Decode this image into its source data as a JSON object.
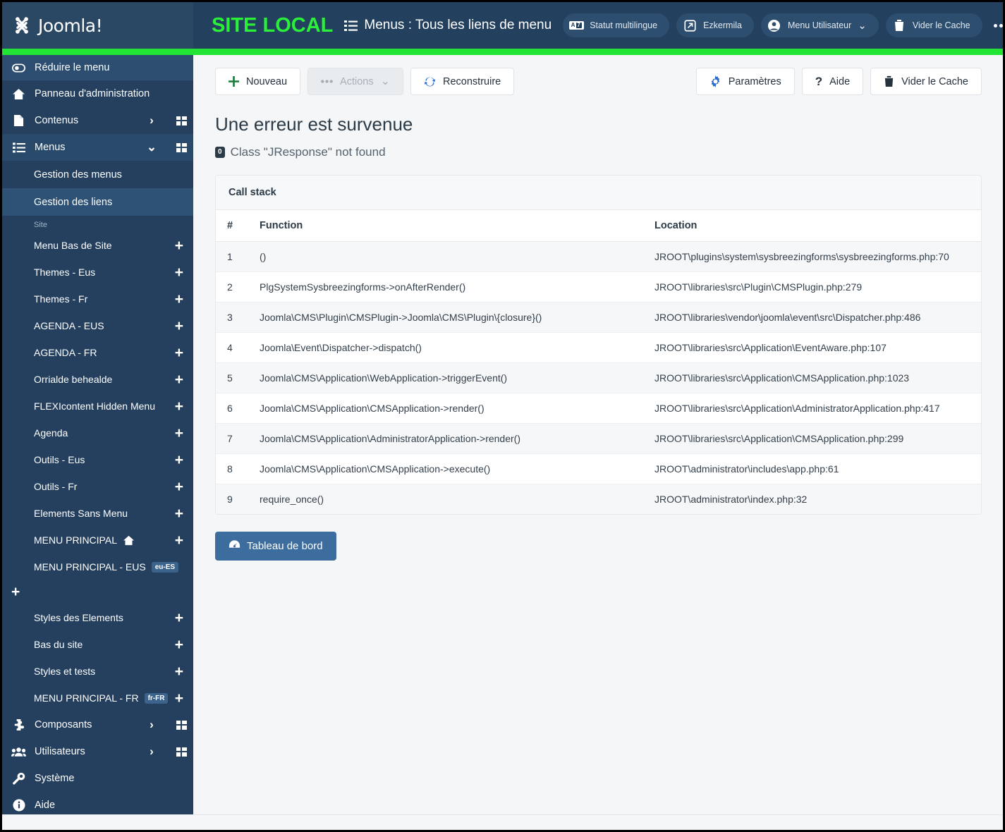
{
  "header": {
    "brand": "Joomla!",
    "site_label": "SITE LOCAL",
    "page_title": "Menus : Tous les liens de menu",
    "buttons": [
      {
        "label": "Statut multilingue",
        "icon": "multilingual-icon"
      },
      {
        "label": "Ezkermila",
        "icon": "external-link-icon"
      },
      {
        "label": "Menu Utilisateur",
        "icon": "user-icon",
        "caret": "⌄"
      },
      {
        "label": "Vider le Cache",
        "icon": "trash-icon"
      }
    ],
    "overflow_label": "•••",
    "accent_green": "#22e434",
    "site_label_color": "#2bf03a"
  },
  "sidebar": {
    "collapse_label": "Réduire le menu",
    "top_items": [
      {
        "label": "Panneau d'administration",
        "icon": "home-icon",
        "caret": "",
        "grid": false,
        "active": false
      },
      {
        "label": "Contenus",
        "icon": "document-icon",
        "caret": "›",
        "grid": true,
        "active": false
      },
      {
        "label": "Menus",
        "icon": "list-icon",
        "caret": "⌄",
        "grid": true,
        "active": true
      }
    ],
    "sub_items": [
      {
        "label": "Gestion des menus",
        "active": false
      },
      {
        "label": "Gestion des liens",
        "active": true
      }
    ],
    "group_label": "Site",
    "menus": [
      {
        "label": "Menu Bas de Site",
        "tag": "",
        "home": false,
        "plus": "+"
      },
      {
        "label": "Themes - Eus",
        "tag": "",
        "home": false,
        "plus": "+"
      },
      {
        "label": "Themes - Fr",
        "tag": "",
        "home": false,
        "plus": "+"
      },
      {
        "label": "AGENDA - EUS",
        "tag": "",
        "home": false,
        "plus": "+"
      },
      {
        "label": "AGENDA - FR",
        "tag": "",
        "home": false,
        "plus": "+"
      },
      {
        "label": "Orrialde behealde",
        "tag": "",
        "home": false,
        "plus": "+"
      },
      {
        "label": "FLEXIcontent Hidden Menu",
        "tag": "",
        "home": false,
        "plus": "+"
      },
      {
        "label": "Agenda",
        "tag": "",
        "home": false,
        "plus": "+"
      },
      {
        "label": "Outils - Eus",
        "tag": "",
        "home": false,
        "plus": "+"
      },
      {
        "label": "Outils - Fr",
        "tag": "",
        "home": false,
        "plus": "+"
      },
      {
        "label": "Elements Sans Menu",
        "tag": "",
        "home": false,
        "plus": "+"
      },
      {
        "label": "MENU PRINCIPAL",
        "tag": "",
        "home": true,
        "plus": "+"
      },
      {
        "label": "MENU PRINCIPAL - EUS",
        "tag": "eu-ES",
        "home": false,
        "plus": ""
      }
    ],
    "orphan_plus": "+",
    "menus2": [
      {
        "label": "Styles des Elements",
        "tag": "",
        "home": false,
        "plus": "+"
      },
      {
        "label": "Bas du site",
        "tag": "",
        "home": false,
        "plus": "+"
      },
      {
        "label": "Styles et tests",
        "tag": "",
        "home": false,
        "plus": "+"
      },
      {
        "label": "MENU PRINCIPAL - FR",
        "tag": "fr-FR",
        "home": false,
        "plus": "+"
      }
    ],
    "bottom_items": [
      {
        "label": "Composants",
        "icon": "puzzle-icon",
        "caret": "›",
        "grid": true
      },
      {
        "label": "Utilisateurs",
        "icon": "users-icon",
        "caret": "›",
        "grid": true
      },
      {
        "label": "Système",
        "icon": "wrench-icon",
        "caret": "",
        "grid": false
      },
      {
        "label": "Aide",
        "icon": "info-icon",
        "caret": "",
        "grid": false
      }
    ]
  },
  "toolbar": {
    "new_label": "Nouveau",
    "actions_label": "Actions",
    "actions_caret": "⌄",
    "rebuild_label": "Reconstruire",
    "options_label": "Paramètres",
    "help_label": "Aide",
    "clear_cache_label": "Vider le Cache"
  },
  "error": {
    "title": "Une erreur est survenue",
    "code_badge": "0",
    "message": "Class \"JResponse\" not found"
  },
  "call_stack": {
    "card_title": "Call stack",
    "columns": [
      "#",
      "Function",
      "Location"
    ],
    "rows": [
      {
        "n": "1",
        "fn": "()",
        "loc": "JROOT\\plugins\\system\\sysbreezingforms\\sysbreezingforms.php:70"
      },
      {
        "n": "2",
        "fn": "PlgSystemSysbreezingforms->onAfterRender()",
        "loc": "JROOT\\libraries\\src\\Plugin\\CMSPlugin.php:279"
      },
      {
        "n": "3",
        "fn": "Joomla\\CMS\\Plugin\\CMSPlugin->Joomla\\CMS\\Plugin\\{closure}()",
        "loc": "JROOT\\libraries\\vendor\\joomla\\event\\src\\Dispatcher.php:486"
      },
      {
        "n": "4",
        "fn": "Joomla\\Event\\Dispatcher->dispatch()",
        "loc": "JROOT\\libraries\\src\\Application\\EventAware.php:107"
      },
      {
        "n": "5",
        "fn": "Joomla\\CMS\\Application\\WebApplication->triggerEvent()",
        "loc": "JROOT\\libraries\\src\\Application\\CMSApplication.php:1023"
      },
      {
        "n": "6",
        "fn": "Joomla\\CMS\\Application\\CMSApplication->render()",
        "loc": "JROOT\\libraries\\src\\Application\\AdministratorApplication.php:417"
      },
      {
        "n": "7",
        "fn": "Joomla\\CMS\\Application\\AdministratorApplication->render()",
        "loc": "JROOT\\libraries\\src\\Application\\CMSApplication.php:299"
      },
      {
        "n": "8",
        "fn": "Joomla\\CMS\\Application\\CMSApplication->execute()",
        "loc": "JROOT\\administrator\\includes\\app.php:61"
      },
      {
        "n": "9",
        "fn": "require_once()",
        "loc": "JROOT\\administrator\\index.php:32"
      }
    ]
  },
  "dashboard_button": {
    "label": "Tableau de bord",
    "icon": "gauge-icon"
  }
}
